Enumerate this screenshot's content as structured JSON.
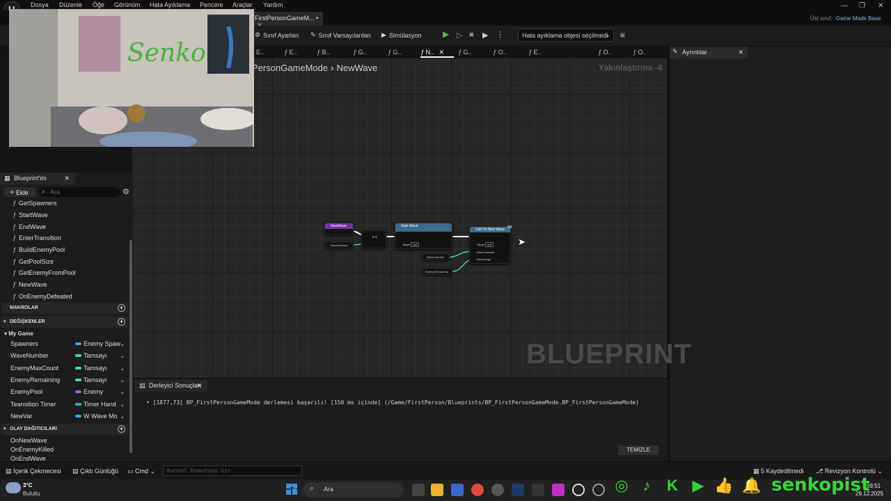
{
  "menu": [
    "Dosya",
    "Düzenle",
    "Öğe",
    "Görünüm",
    "Hata Ayıklama",
    "Pencere",
    "Araçlar",
    "Yardım"
  ],
  "doc_tab": "FirstPersonGameM... •",
  "parent_class_label": "Üst sınıf:",
  "parent_class_value": "Game Mode Base",
  "toolbar": {
    "class_settings": "Sınıf Ayarları",
    "class_defaults": "Sınıf Varsayılanları",
    "simulation": "Simülasyon",
    "debug_object": "Hata ayıklama objesi seçilmedi"
  },
  "fn_tabs": [
    "E..",
    "E..",
    "B..",
    "G..",
    "G..",
    "N..",
    "G..",
    "O..",
    "E..",
    "O..",
    "O.."
  ],
  "details_title": "Ayrıntılar",
  "breadcrumb": {
    "parent": "PersonGameMode",
    "current": "NewWave"
  },
  "zoom": "Yakınlaştırma -4",
  "watermark": "BLUEPRINT",
  "nodes": {
    "event": {
      "title": "NewWave",
      "pin": "WaveNumber"
    },
    "start_wave": {
      "title": "Start Wave",
      "subtitle": "Target is FirstPersonGameMode",
      "target": "Target",
      "self": "self"
    },
    "set_on_new_wave": {
      "title": "Call On New Wave",
      "target": "Target",
      "self": "self",
      "pin1": "Wave Number",
      "pin2": "Remaining"
    },
    "var_wave": "Wave Number",
    "var_enemy": "Enemy Remaining"
  },
  "compiler": {
    "tab": "Derleyici Sonuçları",
    "message": "[1877,73] BP_FirstPersonGameMode derlemesi başarılı! [150 ms içinde] (/Game/FirstPerson/Blueprints/BP_FirstPersonGameMode.BP_FirstPersonGameMode)",
    "clear": "TEMİZLE"
  },
  "left_panel": {
    "tab": "Blueprint'im",
    "add": "Ekle",
    "search_placeholder": "Ara",
    "functions": [
      "GetSpawners",
      "StartWave",
      "EndWave",
      "EnterTransition",
      "BuildEnemyPool",
      "GetPoolSize",
      "GetEnemyFromPool",
      "NewWave",
      "OnEnemyDefeated"
    ],
    "macros": "MAKROLAR",
    "variables_head": "DEĞİŞKENLER",
    "category": "My Game",
    "variables": [
      {
        "name": "Spawners",
        "type": "Enemy Spaw",
        "color": "#37a6e0"
      },
      {
        "name": "WaveNumber",
        "type": "Tamsayı",
        "color": "#3ad9a4"
      },
      {
        "name": "EnemyMaxCount",
        "type": "Tamsayı",
        "color": "#3ad9a4"
      },
      {
        "name": "EnemyRemaining",
        "type": "Tamsayı",
        "color": "#3ad9a4"
      },
      {
        "name": "EnemyPool",
        "type": "Enemy",
        "color": "#a35bd0"
      },
      {
        "name": "Teansition Timer",
        "type": "Timer Hand",
        "color": "#37a6e0"
      },
      {
        "name": "NewVar",
        "type": "W Wave Mo",
        "color": "#37a6e0"
      }
    ],
    "dispatchers_head": "OLAY DAĞITICILARI",
    "dispatchers": [
      "OnNewWave",
      "OnEnemyKilled",
      "OnEndWave"
    ]
  },
  "status": {
    "content_drawer": "İçerik Çekmecesi",
    "output_log": "Çıktı Günlüğü",
    "cmd": "Cmd",
    "console_placeholder": "Konsol Komutunu Gir",
    "unsaved": "5 Kaydedilmedi",
    "revision": "Revizyon Kontrolü"
  },
  "taskbar": {
    "temperature": "3°C",
    "weather": "Bulutlu",
    "search": "Ara",
    "time": "09:51",
    "date": "29.12.2025"
  },
  "overlay_brand": "senkopist"
}
